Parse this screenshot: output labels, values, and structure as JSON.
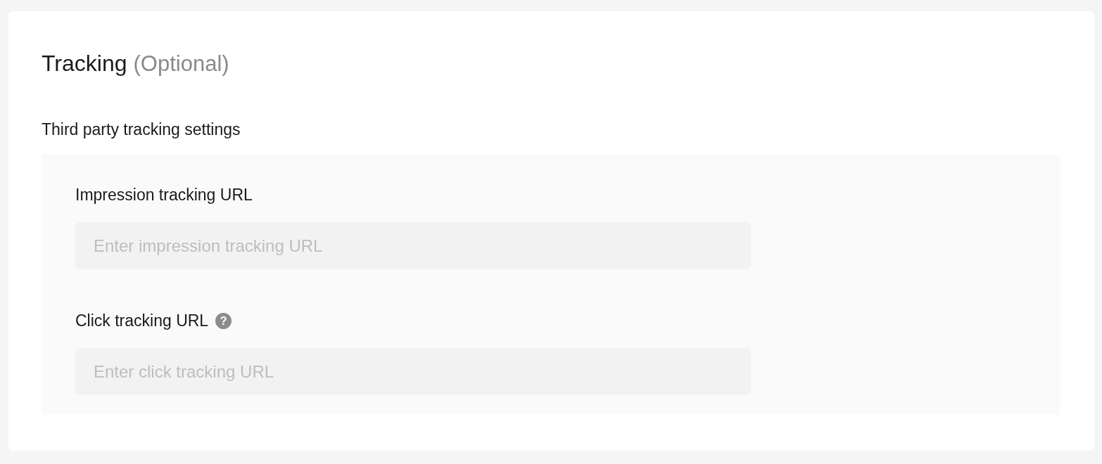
{
  "title": "Tracking",
  "title_note": "(Optional)",
  "section_label": "Third party tracking settings",
  "fields": [
    {
      "label": "Impression tracking URL",
      "placeholder": "Enter impression tracking URL"
    },
    {
      "label": "Click tracking URL",
      "help_icon": "?",
      "placeholder": "Enter click tracking URL"
    }
  ]
}
